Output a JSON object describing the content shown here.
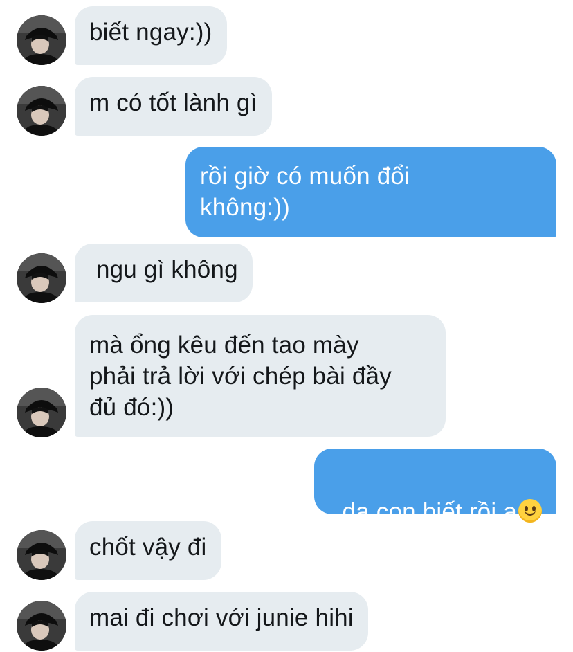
{
  "conversation": {
    "messages": [
      {
        "sender": "other",
        "text": "biết ngay:))",
        "avatar_icon": "user-avatar-icon"
      },
      {
        "sender": "other",
        "text": "m có tốt lành gì",
        "avatar_icon": "user-avatar-icon"
      },
      {
        "sender": "self",
        "text": "rồi giờ có muốn đổi\nkhông:))"
      },
      {
        "sender": "other",
        "text": " ngu gì không",
        "avatar_icon": "user-avatar-icon"
      },
      {
        "sender": "other",
        "text": "mà ổng kêu đến tao mày\nphải trả lời với chép bài đầy\nđủ đó:))",
        "avatar_icon": "user-avatar-icon"
      },
      {
        "sender": "self",
        "text": "dạ con biết rồi ạ",
        "emoji": "slightly-smiling-face-icon"
      },
      {
        "sender": "other",
        "text": "chốt vậy đi",
        "avatar_icon": "user-avatar-icon"
      },
      {
        "sender": "other",
        "text": "mai đi chơi với junie hihi",
        "avatar_icon": "user-avatar-icon"
      }
    ]
  },
  "colors": {
    "incoming_bubble": "#e6ecf0",
    "outgoing_bubble": "#4a9fe9",
    "incoming_text": "#14171a",
    "outgoing_text": "#ffffff"
  }
}
